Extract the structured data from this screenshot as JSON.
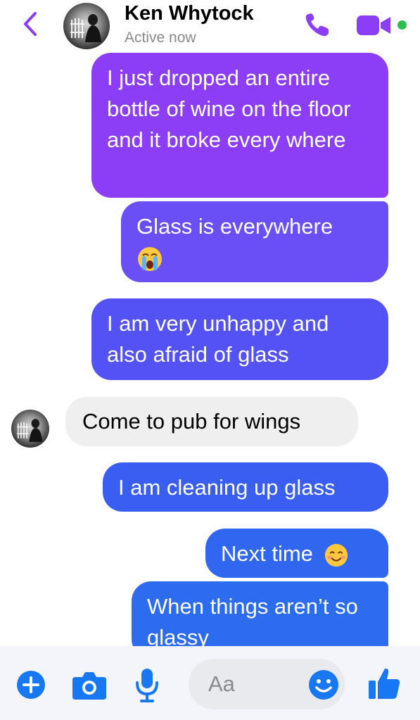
{
  "header": {
    "contact_name": "Ken Whytock",
    "status": "Active now"
  },
  "messages": [
    {
      "sender": "me",
      "text": "I just dropped an entire bottle of wine on the floor and it broke every where"
    },
    {
      "sender": "me",
      "text": "Glass is everywhere",
      "emoji": "loudly-crying-face"
    },
    {
      "sender": "me",
      "text": "I am very unhappy and also afraid of glass"
    },
    {
      "sender": "contact",
      "text": "Come to pub for wings"
    },
    {
      "sender": "me",
      "text": "I am cleaning up glass"
    },
    {
      "sender": "me",
      "text": "Next time",
      "emoji": "smiling-face-with-smiling-eyes"
    },
    {
      "sender": "me",
      "text": "When things aren’t so glassy"
    }
  ],
  "composer": {
    "placeholder": "Aa"
  },
  "colors": {
    "accent": "#8b3ef6",
    "bubble_gradient": [
      "#8b3ef6",
      "#6a4ef6",
      "#5452f4",
      "#3b5ef2",
      "#2d6bef"
    ],
    "incoming_bubble": "#efefef",
    "online": "#2bbf4f",
    "composer_icons": "#1877f2"
  },
  "icons": [
    "back-icon",
    "phone-icon",
    "video-camera-icon",
    "plus-icon",
    "camera-icon",
    "microphone-icon",
    "emoji-icon",
    "thumbs-up-icon"
  ]
}
